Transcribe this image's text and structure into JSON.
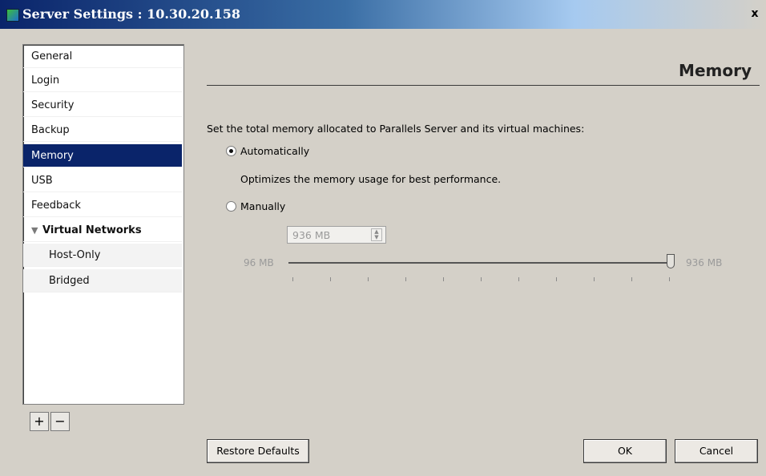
{
  "window": {
    "title": "Server Settings : 10.30.20.158",
    "close_label": "x"
  },
  "sidebar": {
    "items": [
      {
        "label": "General",
        "selected": false
      },
      {
        "label": "Login",
        "selected": false
      },
      {
        "label": "Security",
        "selected": false
      },
      {
        "label": "Backup",
        "selected": false
      },
      {
        "label": "Memory",
        "selected": true
      },
      {
        "label": "USB",
        "selected": false
      },
      {
        "label": "Feedback",
        "selected": false
      },
      {
        "label": "Virtual Networks",
        "expanded": true
      },
      {
        "label": "Host-Only",
        "selected": false
      },
      {
        "label": "Bridged",
        "selected": false
      }
    ],
    "add_label": "+",
    "remove_label": "−"
  },
  "main": {
    "section_title": "Memory",
    "description": "Set the total memory allocated to Parallels Server and its virtual machines:",
    "auto_option": {
      "label": "Automatically",
      "checked": true
    },
    "auto_hint": "Optimizes the memory usage for best performance.",
    "manual_option": {
      "label": "Manually",
      "checked": false
    },
    "memory_value": "936 MB",
    "slider": {
      "min_label": "96 MB",
      "max_label": "936 MB",
      "value_fraction": 1.0
    }
  },
  "footer": {
    "restore_label": "Restore Defaults",
    "ok_label": "OK",
    "cancel_label": "Cancel"
  },
  "colors": {
    "selected_bg": "#0a246a",
    "titlebar_start": "#0a246a",
    "window_bg": "#d4d0c8"
  },
  "icons": {
    "app": "server-settings-icon",
    "close": "close-icon",
    "expand": "triangle-down-icon"
  }
}
